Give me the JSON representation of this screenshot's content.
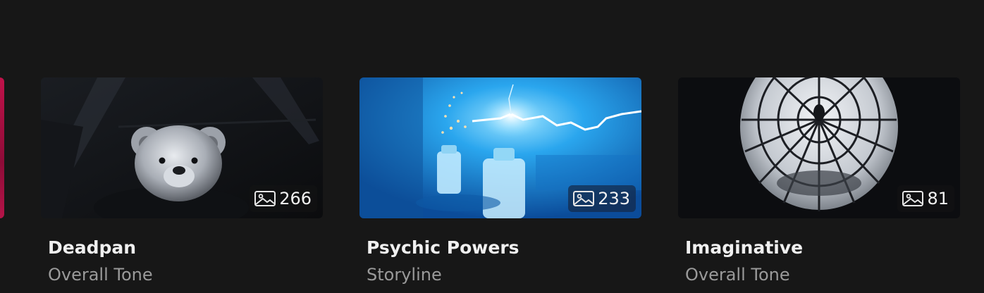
{
  "cards": [
    {
      "title": "Deadpan",
      "subtitle": "Overall Tone",
      "image_count": "266",
      "thumbnail": "teddy-bear-image"
    },
    {
      "title": "Psychic Powers",
      "subtitle": "Storyline",
      "image_count": "233",
      "thumbnail": "lightning-bottles-image"
    },
    {
      "title": "Imaginative",
      "subtitle": "Overall Tone",
      "image_count": "81",
      "thumbnail": "spider-web-window-image"
    }
  ],
  "icons": {
    "count_icon": "image-icon"
  },
  "colors": {
    "background": "#171717",
    "title": "#f0f0f0",
    "subtitle": "#9a9a9a",
    "edge_card": "#c0124a"
  }
}
